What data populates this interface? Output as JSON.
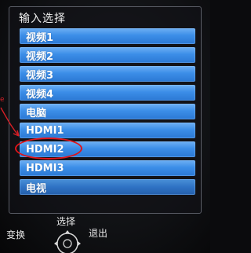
{
  "menu": {
    "title": "输入选择",
    "items": [
      {
        "label": "视频1"
      },
      {
        "label": "视频2"
      },
      {
        "label": "视频3"
      },
      {
        "label": "视频4"
      },
      {
        "label": "电脑"
      },
      {
        "label": "HDMI1"
      },
      {
        "label": "HDMI2"
      },
      {
        "label": "HDMI3"
      },
      {
        "label": "电视"
      }
    ]
  },
  "footer": {
    "select_label": "选择",
    "switch_label": "变换",
    "exit_label": "退出"
  },
  "side_glyph": "e",
  "colors": {
    "item_blue": "#3c8ee8",
    "annotation_red": "#e0141a",
    "panel_border": "#5a5d66"
  },
  "icons": [
    "remote-dpad-icon",
    "annotation-arrow-icon",
    "highlight-circle"
  ]
}
